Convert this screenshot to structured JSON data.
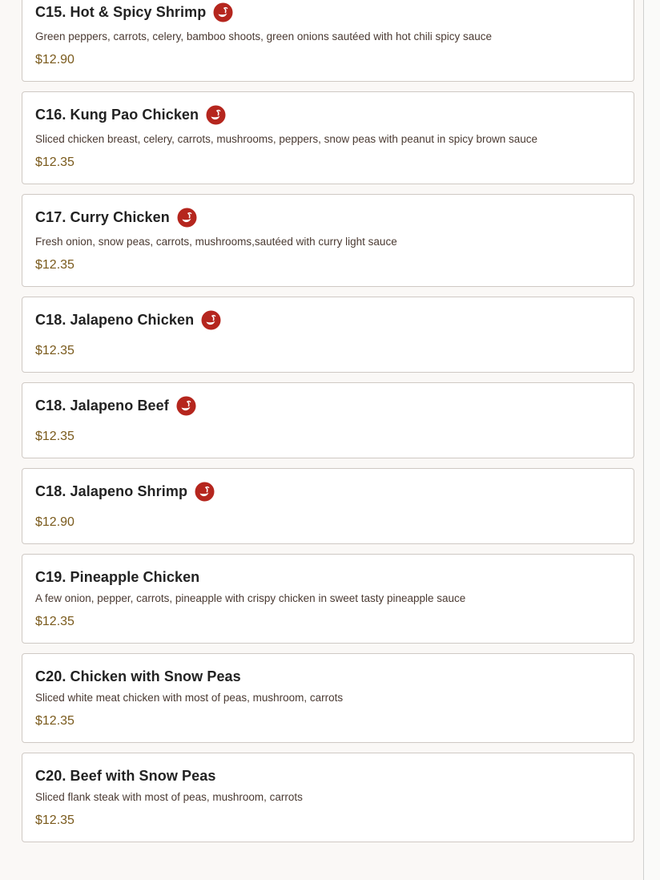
{
  "colors": {
    "spicy_badge": "#b5261e",
    "price": "#7a5a1c",
    "title": "#222222"
  },
  "items": [
    {
      "title": "C15. Hot & Spicy Shrimp",
      "spicy": true,
      "spicy_icon": "chili-pepper-icon",
      "desc": "Green peppers, carrots, celery, bamboo shoots, green onions sautéed with hot chili spicy sauce",
      "price": "$12.90"
    },
    {
      "title": "C16. Kung Pao Chicken",
      "spicy": true,
      "spicy_icon": "chili-pepper-icon",
      "desc": "Sliced chicken breast, celery, carrots, mushrooms, peppers, snow peas with peanut in spicy brown sauce",
      "price": "$12.35"
    },
    {
      "title": "C17. Curry Chicken",
      "spicy": true,
      "spicy_icon": "chili-pepper-icon",
      "desc": "Fresh onion, snow peas, carrots, mushrooms,sautéed with curry light sauce",
      "price": "$12.35"
    },
    {
      "title": "C18. Jalapeno Chicken",
      "spicy": true,
      "spicy_icon": "chili-pepper-icon",
      "desc": "",
      "price": "$12.35"
    },
    {
      "title": "C18. Jalapeno Beef",
      "spicy": true,
      "spicy_icon": "chili-pepper-icon",
      "desc": "",
      "price": "$12.35"
    },
    {
      "title": "C18. Jalapeno Shrimp",
      "spicy": true,
      "spicy_icon": "chili-pepper-icon",
      "desc": "",
      "price": "$12.90"
    },
    {
      "title": "C19. Pineapple Chicken",
      "spicy": false,
      "desc": "A few onion, pepper, carrots, pineapple with crispy chicken in sweet tasty pineapple sauce",
      "price": "$12.35"
    },
    {
      "title": "C20. Chicken with Snow Peas",
      "spicy": false,
      "desc": "Sliced white meat chicken with most of peas, mushroom, carrots",
      "price": "$12.35"
    },
    {
      "title": "C20. Beef with Snow Peas",
      "spicy": false,
      "desc": "Sliced flank steak with most of peas, mushroom, carrots",
      "price": "$12.35"
    }
  ]
}
